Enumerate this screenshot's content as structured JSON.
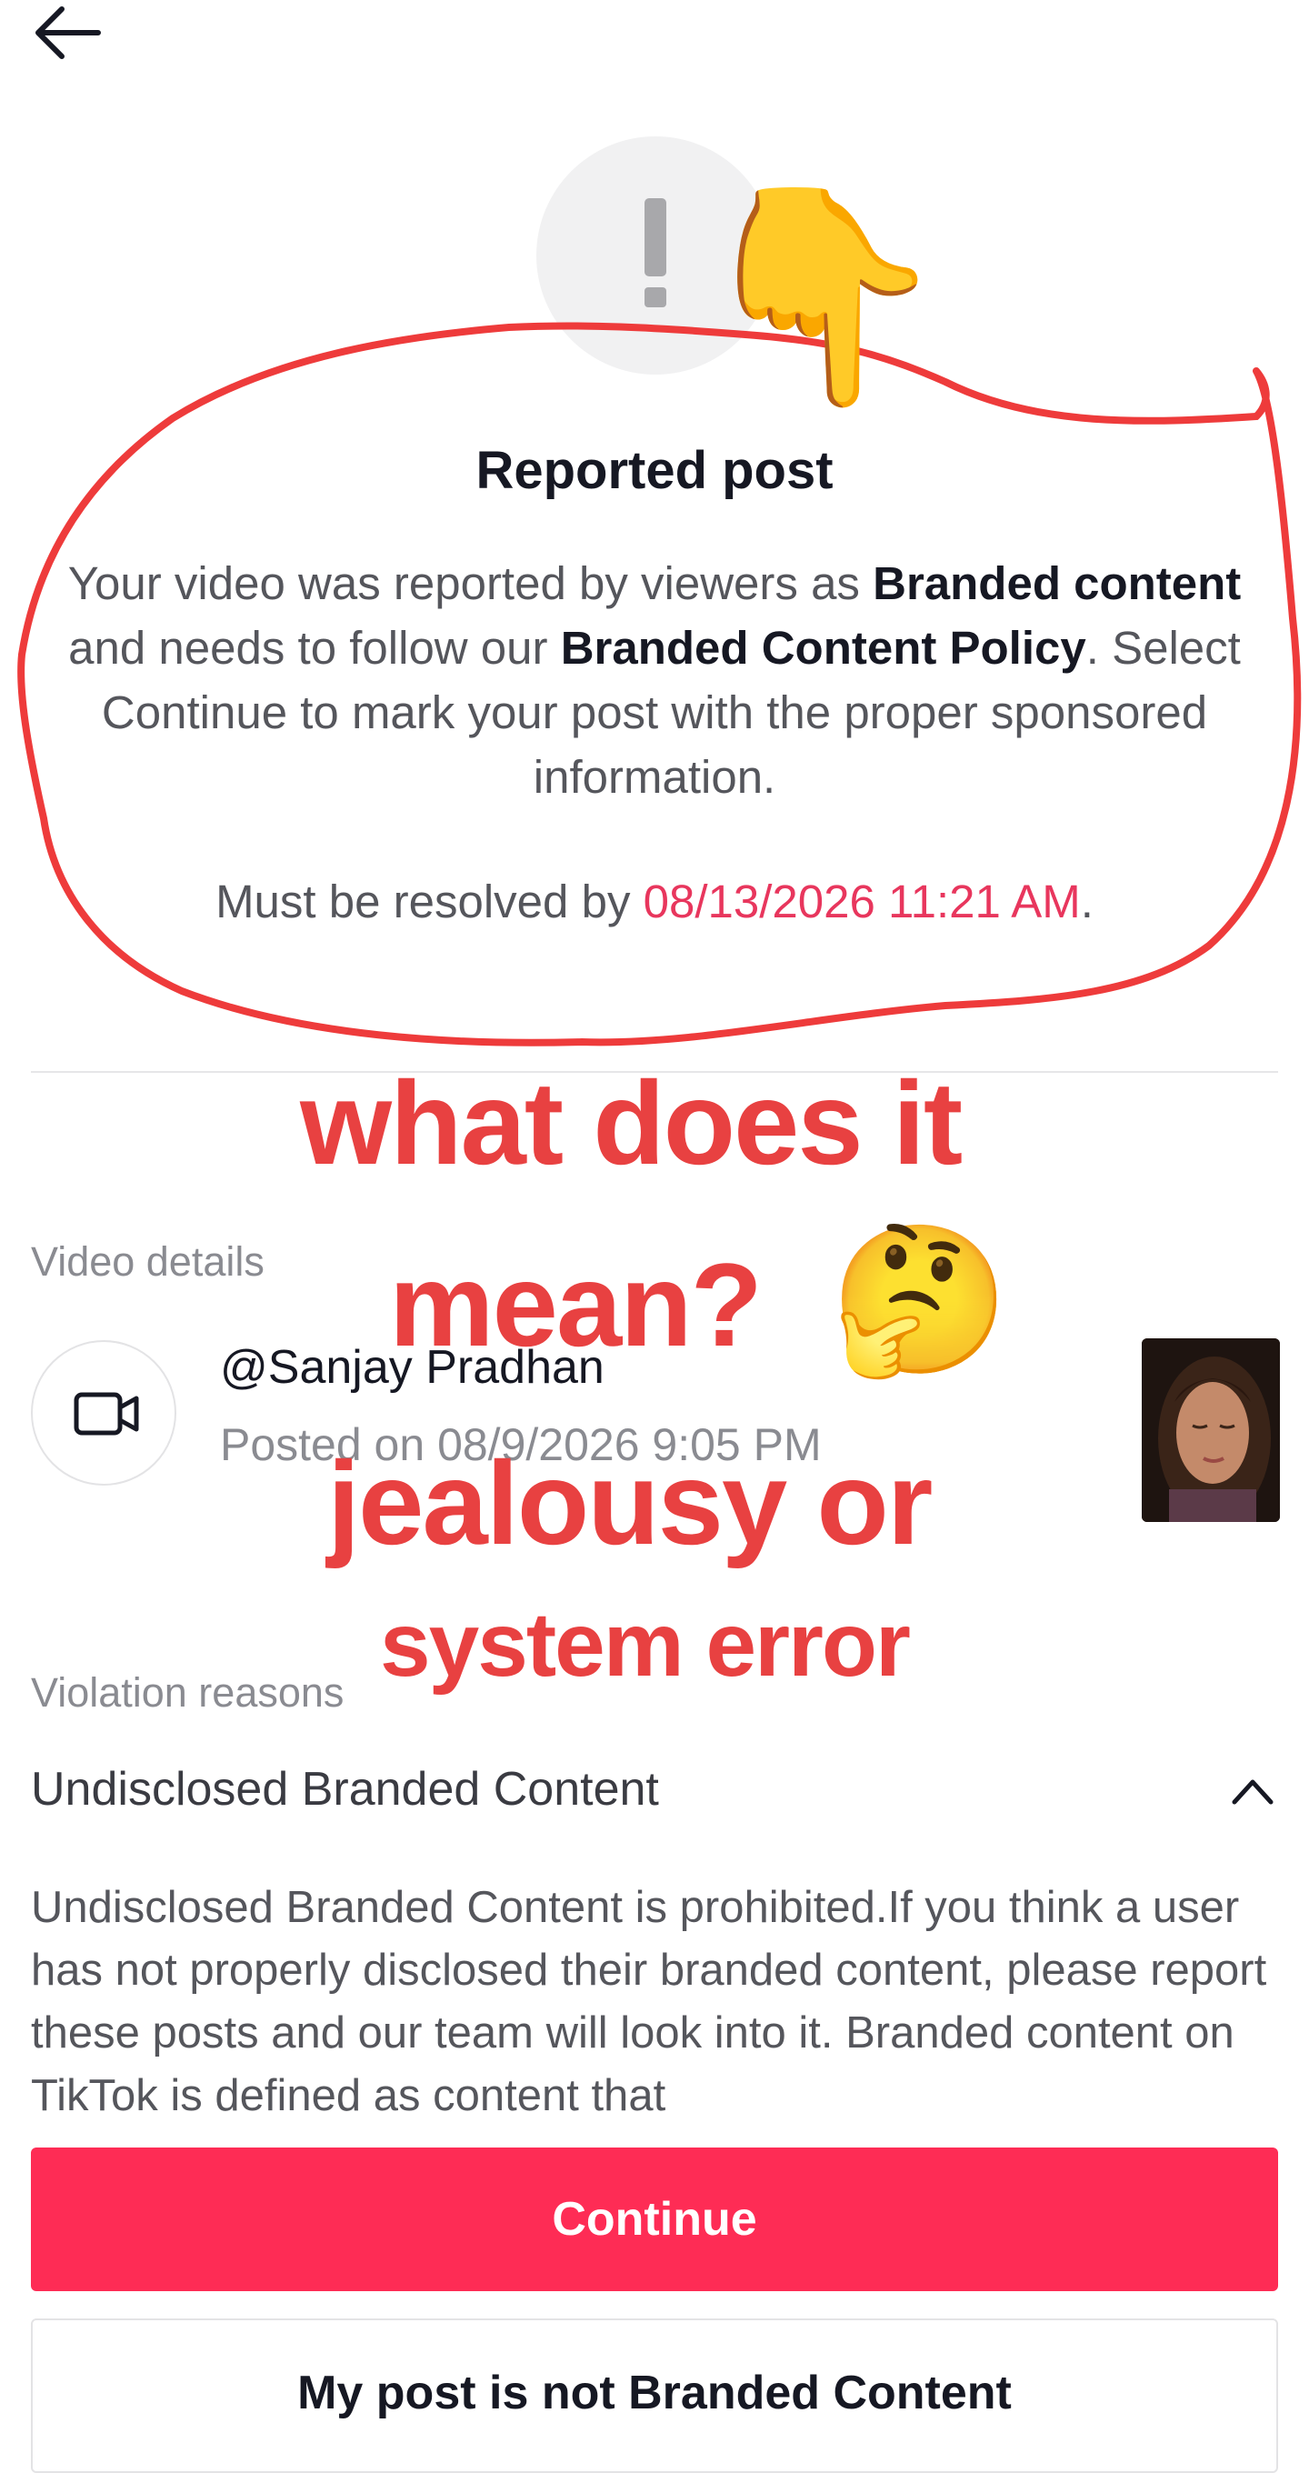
{
  "header": {
    "back_icon": "arrow-left-icon"
  },
  "notice": {
    "icon": "exclamation-icon",
    "title": "Reported post",
    "desc_part1": "Your video was reported by viewers as ",
    "desc_bold1": "Branded content",
    "desc_part2": " and needs to follow our ",
    "desc_bold2": "Branded Content Policy",
    "desc_part3": ". Select Continue to mark your post with the proper sponsored information.",
    "resolve_prefix": "Must be resolved by ",
    "resolve_date": "08/13/2026 11:21 AM",
    "resolve_suffix": "."
  },
  "video_details": {
    "label": "Video details",
    "icon": "video-camera-icon",
    "username": "@Sanjay Pradhan",
    "posted": "Posted on 08/9/2026 9:05 PM"
  },
  "violation": {
    "label": "Violation reasons",
    "reason": "Undisclosed Branded Content",
    "chevron_icon": "chevron-up-icon",
    "body": "Undisclosed Branded Content is prohibited.If you think a user has not properly disclosed their branded content, please report these posts and our team will look into it. Branded content on TikTok is defined as content that"
  },
  "actions": {
    "continue_label": "Continue",
    "not_branded_label": "My post is not Branded Content"
  },
  "overlay": {
    "line1": "what does it",
    "line2": "mean?",
    "line3": "jealousy or",
    "line4": "system error",
    "emoji_pointing": "👇",
    "emoji_thinking": "🤔",
    "annotation_color": "#e84141"
  },
  "colors": {
    "accent": "#fe2c55",
    "date_highlight": "#e8365d"
  }
}
